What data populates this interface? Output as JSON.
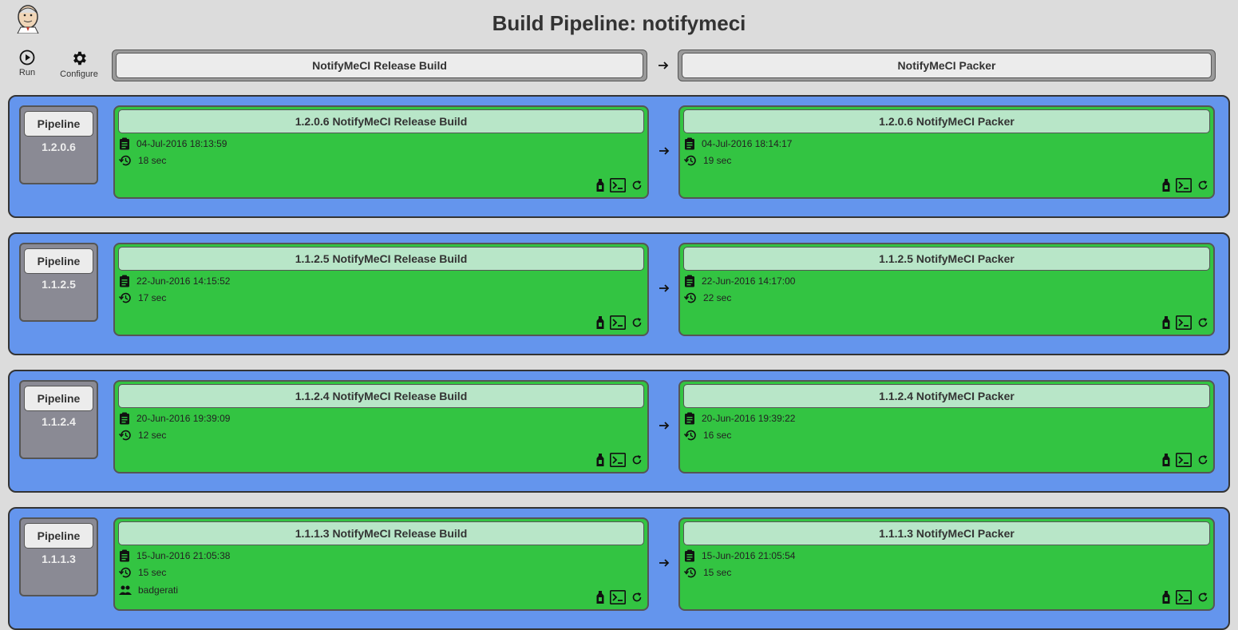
{
  "page": {
    "title": "Build Pipeline: notifymeci"
  },
  "toolbar": {
    "run_label": "Run",
    "configure_label": "Configure"
  },
  "header_jobs": [
    {
      "name": "NotifyMeCI Release Build"
    },
    {
      "name": "NotifyMeCI Packer"
    }
  ],
  "pipeline_label": "Pipeline",
  "colors": {
    "background": "#dcdcdc",
    "row": "#6495ed",
    "success": "#33c442",
    "build_title": "#b8e6c8"
  },
  "rows": [
    {
      "version": "1.2.0.6",
      "builds": [
        {
          "title": "1.2.0.6 NotifyMeCI Release Build",
          "date": "04-Jul-2016 18:13:59",
          "duration": "18 sec"
        },
        {
          "title": "1.2.0.6 NotifyMeCI Packer",
          "date": "04-Jul-2016 18:14:17",
          "duration": "19 sec"
        }
      ]
    },
    {
      "version": "1.1.2.5",
      "builds": [
        {
          "title": "1.1.2.5 NotifyMeCI Release Build",
          "date": "22-Jun-2016 14:15:52",
          "duration": "17 sec"
        },
        {
          "title": "1.1.2.5 NotifyMeCI Packer",
          "date": "22-Jun-2016 14:17:00",
          "duration": "22 sec"
        }
      ]
    },
    {
      "version": "1.1.2.4",
      "builds": [
        {
          "title": "1.1.2.4 NotifyMeCI Release Build",
          "date": "20-Jun-2016 19:39:09",
          "duration": "12 sec"
        },
        {
          "title": "1.1.2.4 NotifyMeCI Packer",
          "date": "20-Jun-2016 19:39:22",
          "duration": "16 sec"
        }
      ]
    },
    {
      "version": "1.1.1.3",
      "builds": [
        {
          "title": "1.1.1.3 NotifyMeCI Release Build",
          "date": "15-Jun-2016 21:05:38",
          "duration": "15 sec",
          "user": "badgerati"
        },
        {
          "title": "1.1.1.3 NotifyMeCI Packer",
          "date": "15-Jun-2016 21:05:54",
          "duration": "15 sec"
        }
      ]
    }
  ]
}
